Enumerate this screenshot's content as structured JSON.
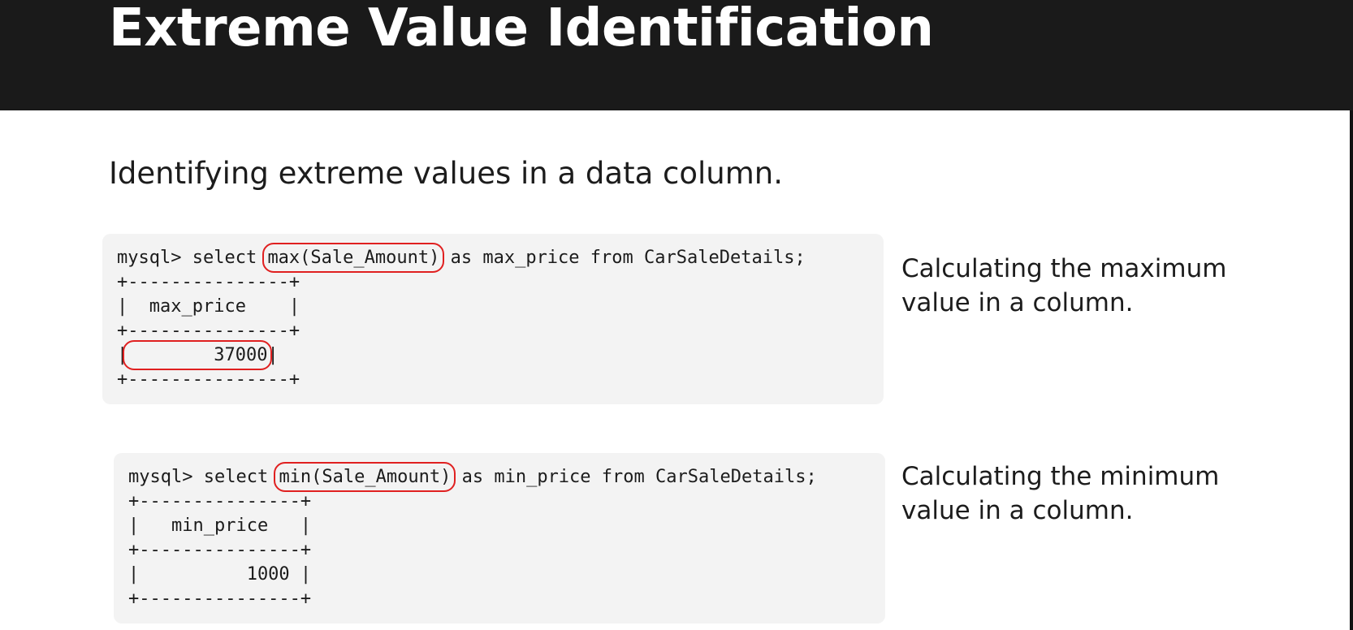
{
  "slide": {
    "title": "Extreme Value Identification",
    "subtitle": "Identifying extreme values in a data column."
  },
  "examples": [
    {
      "prompt": "mysql> select ",
      "highlight": "max(Sale_Amount)",
      "query_rest": " as max_price from CarSaleDetails;",
      "border": "+---------------+",
      "header": "|  max_price    |",
      "result_left": "|",
      "result_value": "        37000",
      "result_right": "|",
      "description": "Calculating the maximum value in a column."
    },
    {
      "prompt": "mysql> select ",
      "highlight": "min(Sale_Amount)",
      "query_rest": " as min_price from CarSaleDetails;",
      "border": "+---------------+",
      "header": "|   min_price   |",
      "result_row": "|          1000 |",
      "description": "Calculating the minimum value in a column."
    }
  ],
  "colors": {
    "title_bar": "#1a1a1a",
    "panel": "#f3f3f3",
    "highlight_outline": "#e02020"
  }
}
